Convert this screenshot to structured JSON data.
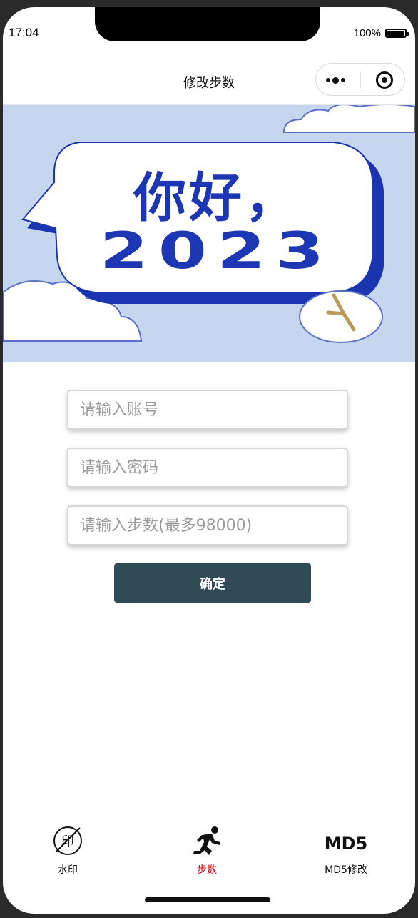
{
  "status_bar": {
    "time": "17:04",
    "battery": "100%"
  },
  "navbar": {
    "title": "修改步数"
  },
  "banner": {
    "line1": "你好，",
    "line2": "2023"
  },
  "form": {
    "account_placeholder": "请输入账号",
    "password_placeholder": "请输入密码",
    "steps_placeholder": "请输入步数(最多98000)",
    "submit_label": "确定"
  },
  "tabbar": {
    "tabs": [
      {
        "label": "水印",
        "icon": "watermark-off-icon",
        "active": false
      },
      {
        "label": "步数",
        "icon": "running-man-icon",
        "active": true
      },
      {
        "label": "MD5修改",
        "icon": "md5-icon",
        "active": false,
        "icon_text": "MD5"
      }
    ]
  },
  "colors": {
    "accent_active": "#e60012",
    "button_bg": "#314b55",
    "banner_bg": "#c5d6ef",
    "banner_text": "#1c36b4"
  }
}
